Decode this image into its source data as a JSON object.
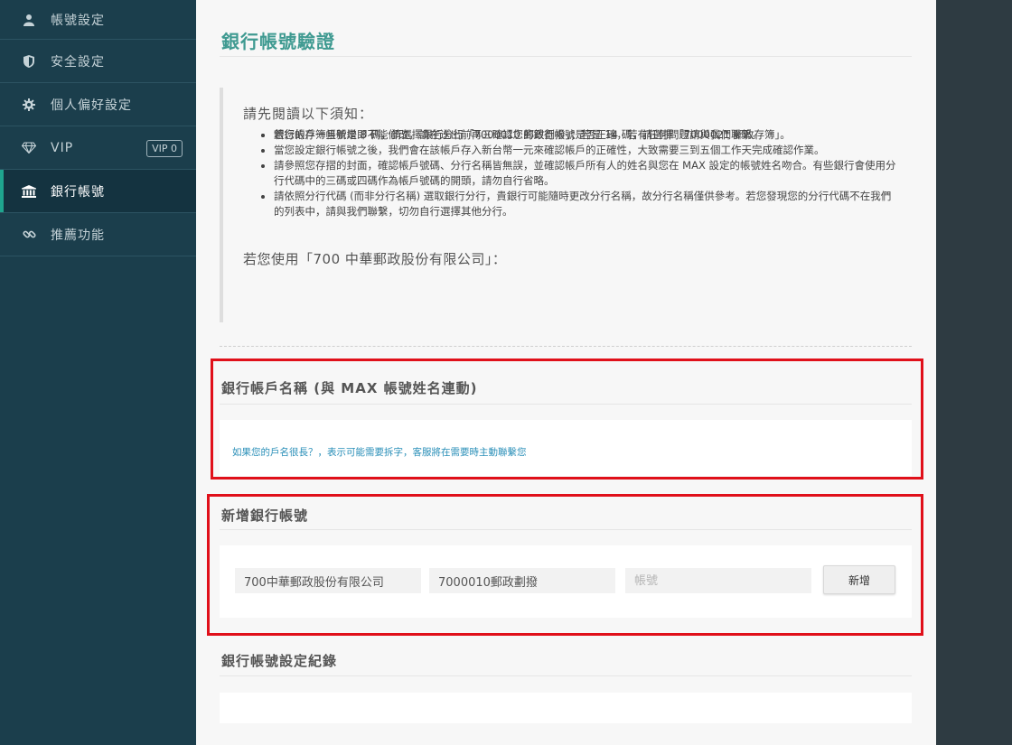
{
  "sidebar": {
    "items": [
      {
        "label": "帳號設定",
        "icon": "user-icon"
      },
      {
        "label": "安全設定",
        "icon": "shield-icon"
      },
      {
        "label": "個人偏好設定",
        "icon": "gear-icon"
      },
      {
        "label": "VIP",
        "icon": "diamond-icon",
        "badge": "VIP 0"
      },
      {
        "label": "銀行帳號",
        "icon": "bank-icon",
        "active": true
      },
      {
        "label": "推薦功能",
        "icon": "link-icon"
      }
    ]
  },
  "page": {
    "title": "銀行帳號驗證"
  },
  "notice": {
    "heading": "請先閱讀以下須知：",
    "items": [
      "銀行帳戶一旦新增即不能修改，請在送出前再三確認您的銀行帳號是否正確，若有任何問題請與我們聯繫。",
      "當您設定銀行帳號之後，我們會在該帳戶存入新台幣一元來確認帳戶的正確性，大致需要三到五個工作天完成確認作業。",
      "請參照您存摺的封面，確認帳戶號碼、分行名稱皆無誤，並確認帳戶所有人的姓名與您在 MAX 設定的帳號姓名吻合。有些銀行會使用分行代碼中的三碼或四碼作為帳戶號碼的開頭，請勿自行省略。",
      "請依照分行代碼 (而非分行名稱) 選取銀行分行，貴銀行可能隨時更改分行名稱，故分行名稱僅供參考。若您發現您的分行代碼不在我們的列表中，請與我們聯繫，切勿自行選擇其他分行。"
    ],
    "postal_heading": "若您使用「700 中華郵政股份有限公司」：",
    "postal_items": [
      "若您的存簿帳號是 8 碼，請選擇銀行分行「7000010 郵政劃撥」；若是 14 碼，請選擇「7000021 郵政存簿」。"
    ]
  },
  "account_name": {
    "title": "銀行帳戶名稱 (與 MAX 帳號姓名連動)",
    "link": "如果您的戶名很長？，表示可能需要拆字，客服將在需要時主動聯繫您"
  },
  "add_account": {
    "title": "新增銀行帳號",
    "bank_value": "700中華郵政股份有限公司",
    "branch_value": "7000010郵政劃撥",
    "account_placeholder": "帳號",
    "submit_label": "新增"
  },
  "history": {
    "title": "銀行帳號設定紀錄"
  },
  "colors": {
    "sidebar_bg": "#1b3e4c",
    "accent": "#1fa58f",
    "title": "#3f9a91",
    "link": "#2a8fb8",
    "highlight": "#e0101a"
  }
}
